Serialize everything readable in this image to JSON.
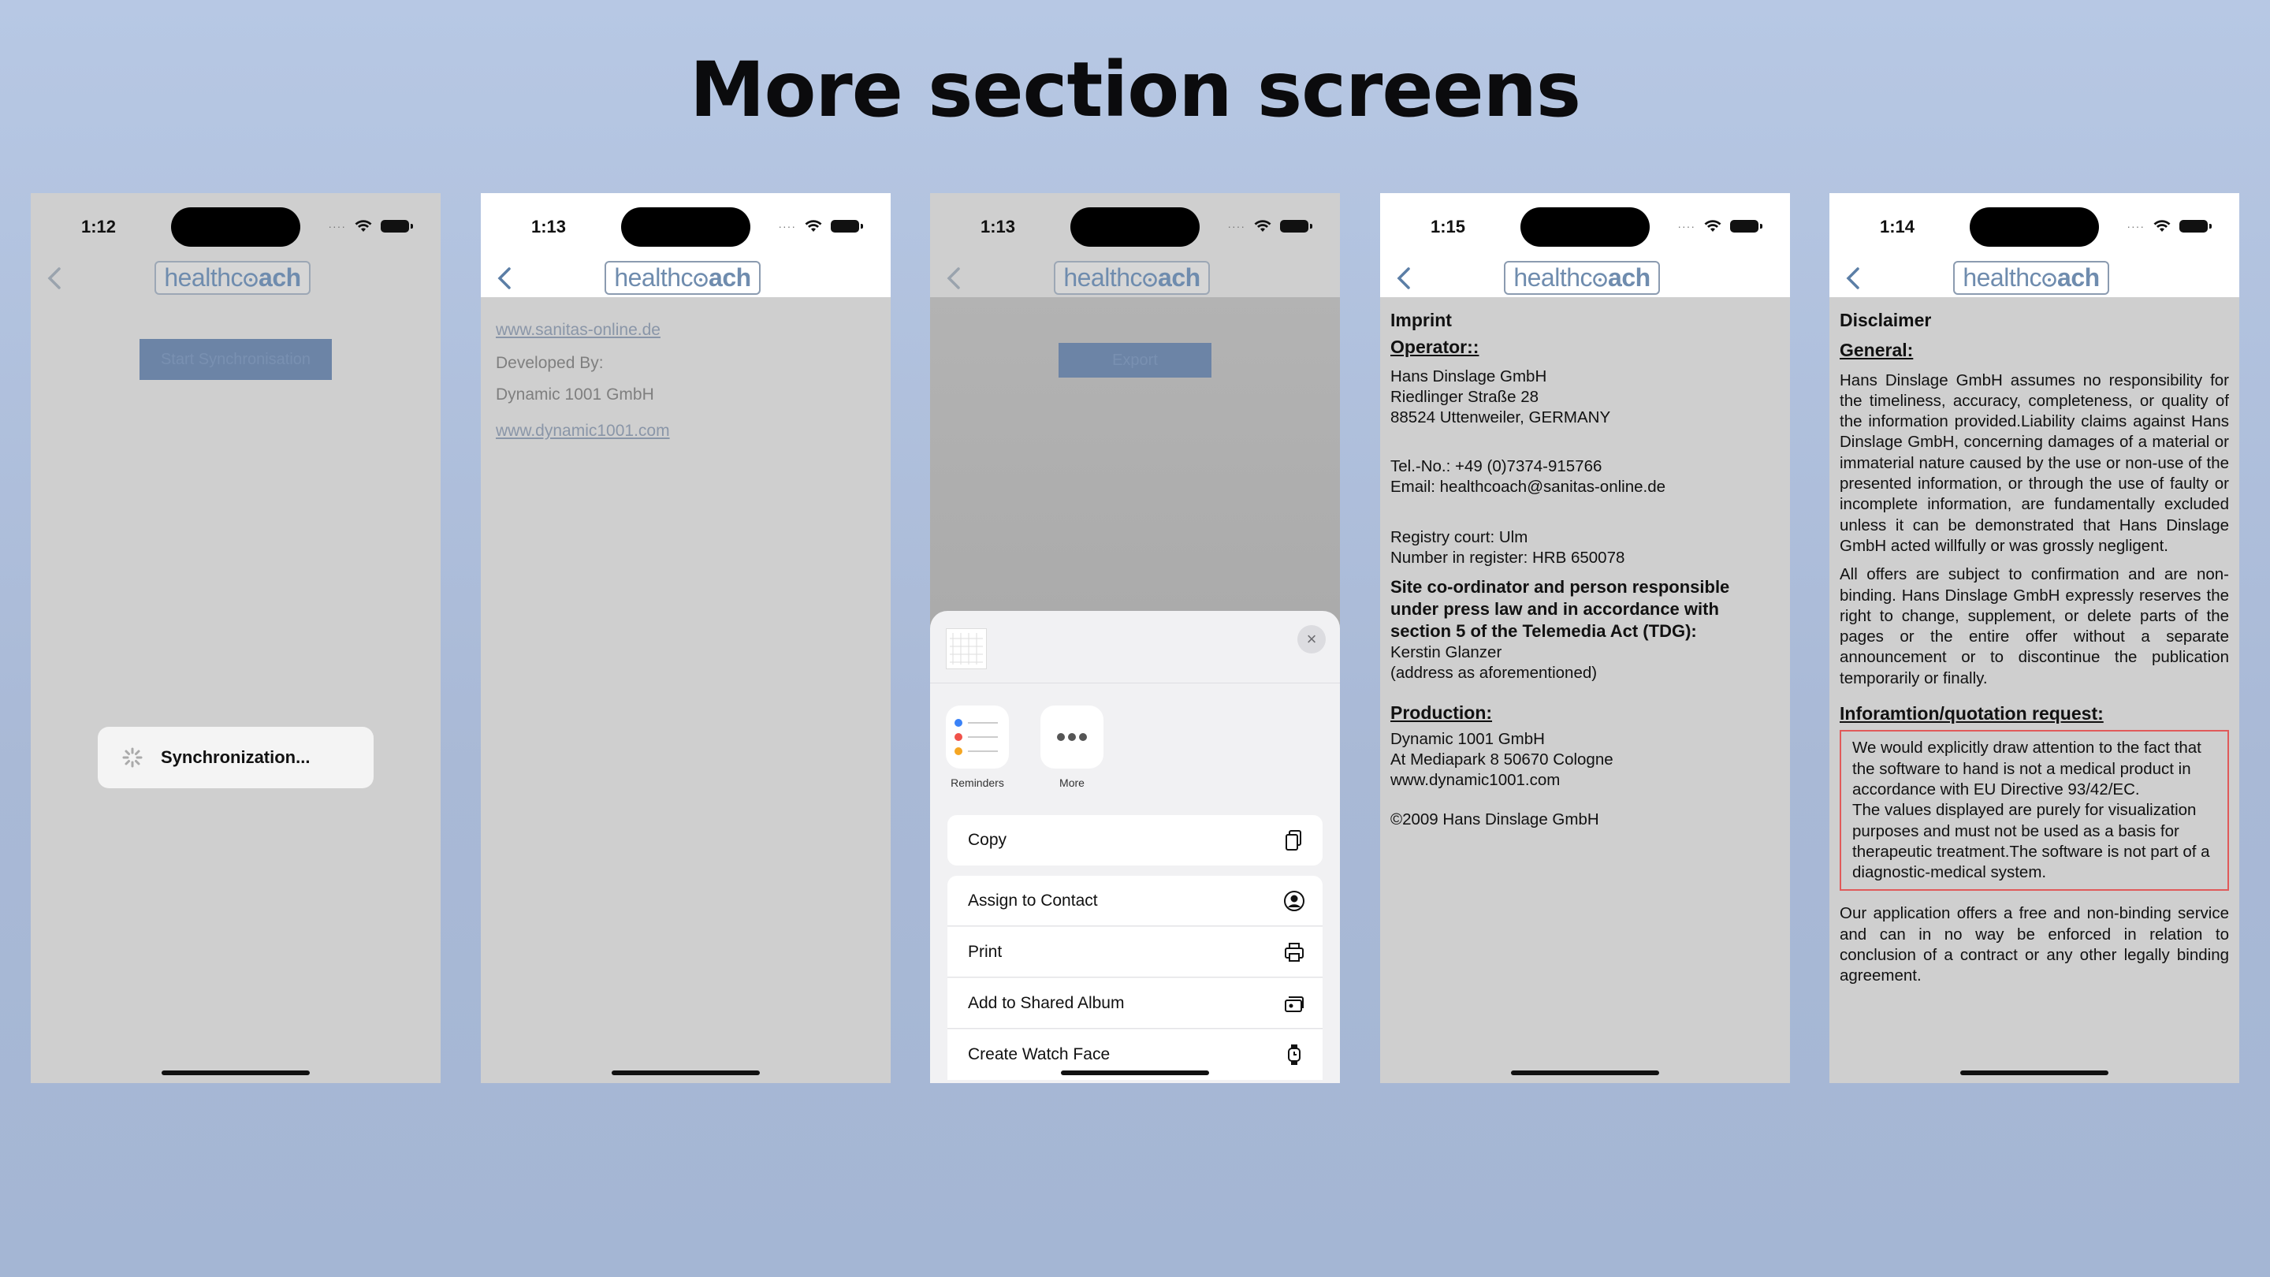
{
  "page_title": "More section screens",
  "brand": {
    "logo_part1": "healthc",
    "logo_part2": "ach"
  },
  "phones": [
    {
      "time": "1:12",
      "button": "Start Synchronisation",
      "hud": "Synchronization..."
    },
    {
      "time": "1:13",
      "link1": "www.sanitas-online.de",
      "developed_by": "Developed By:",
      "company": "Dynamic 1001 GmbH",
      "link2": "www.dynamic1001.com"
    },
    {
      "time": "1:13",
      "button": "Export",
      "apps": [
        "Reminders",
        "More"
      ],
      "actions": [
        "Copy",
        "Assign to Contact",
        "Print",
        "Add to Shared Album",
        "Create Watch Face"
      ],
      "close": "×"
    },
    {
      "time": "1:15",
      "title": "Imprint",
      "operator_h": "Operator::",
      "op1": "Hans Dinslage GmbH",
      "op2": "Riedlinger Straße 28",
      "op3": "88524 Uttenweiler, GERMANY",
      "tel": "Tel.-No.: +49 (0)7374-915766",
      "email": "Email: healthcoach@sanitas-online.de",
      "reg1": "Registry court: Ulm",
      "reg2": "Number in register: HRB 650078",
      "site": "Site co-ordinator and person responsible under press law and in accordance with section 5 of the Telemedia Act (TDG):",
      "person": "Kerstin Glanzer",
      "address_note": "(address as aforementioned)",
      "production_h": "Production:",
      "prod1": "Dynamic 1001 GmbH",
      "prod2": "At Mediapark 8 50670 Cologne",
      "prod3": "www.dynamic1001.com",
      "copyright": "©2009 Hans Dinslage GmbH"
    },
    {
      "time": "1:14",
      "title": "Disclaimer",
      "general_h": "General:",
      "general_p1": "Hans Dinslage GmbH assumes no responsibility for the timeliness, accuracy, completeness, or quality of the information provided.Liability claims against Hans Dinslage GmbH, concerning damages of a material or immaterial nature caused by the use or non-use of the presented information, or through the use of faulty or incomplete information, are fundamentally excluded unless it can be demonstrated that Hans Dinslage GmbH acted willfully or was grossly negligent.",
      "general_p2": "All offers are subject to confirmation and are non-binding. Hans Dinslage GmbH expressly reserves the right to change, supplement, or delete parts of the pages or the entire offer without a separate announcement or to discontinue the publication temporarily or finally.",
      "info_h": "Inforamtion/quotation request:",
      "box_p1": "We would explicitly draw attention to the fact that the software to hand is not a medical product in accordance with EU Directive 93/42/EC.",
      "box_p2": "The values displayed are purely for visualization purposes and must not be used as a basis for therapeutic treatment.The software is not part of a diagnostic-medical system.",
      "last_p": "Our application offers a free and non-binding service and can in no way be enforced in relation to conclusion of a contract or any other legally binding agreement."
    }
  ]
}
